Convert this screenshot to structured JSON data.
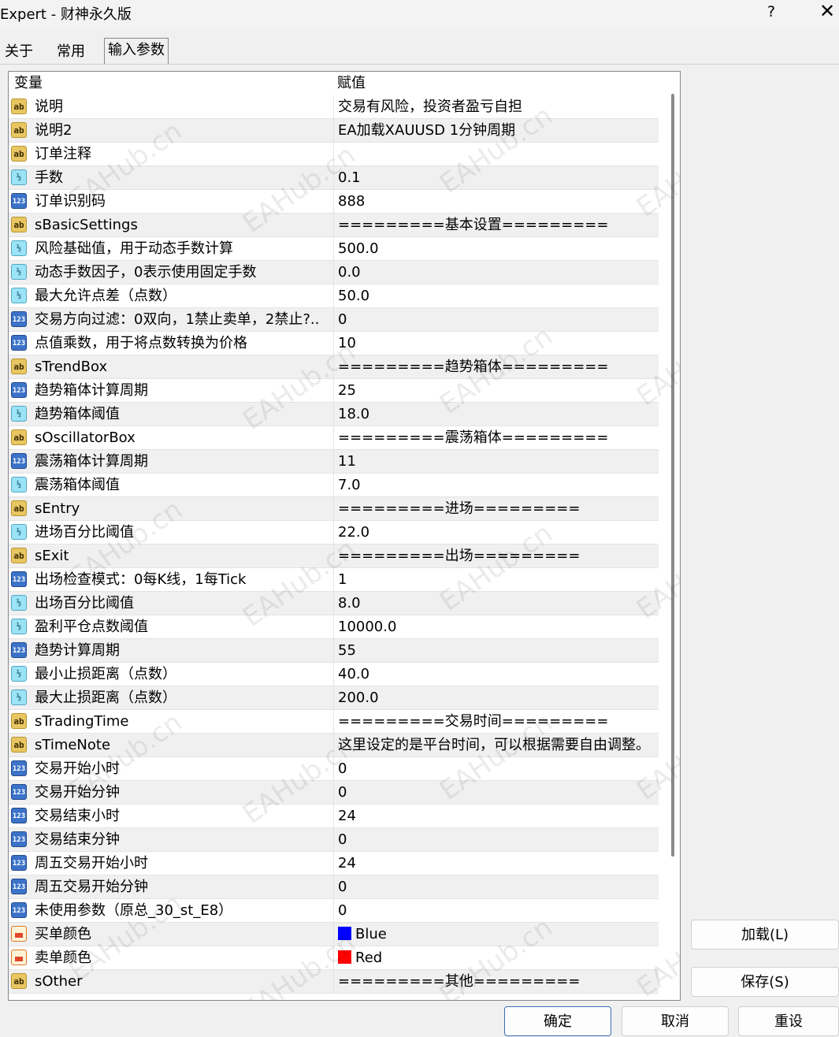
{
  "window": {
    "title": "Expert - 财神永久版",
    "help_label": "?",
    "close_label": "✕"
  },
  "tabs": [
    {
      "label": "关于"
    },
    {
      "label": "常用"
    },
    {
      "label": "输入参数",
      "active": true
    }
  ],
  "table": {
    "headers": {
      "name": "变量",
      "value": "赋值"
    },
    "rows": [
      {
        "type": "ab",
        "name": "说明",
        "value": "交易有风险，投资者盈亏自担"
      },
      {
        "type": "ab",
        "name": "说明2",
        "value": "EA加载XAUUSD 1分钟周期"
      },
      {
        "type": "ab",
        "name": "订单注释",
        "value": ""
      },
      {
        "type": "half",
        "name": "手数",
        "value": "0.1"
      },
      {
        "type": "num",
        "name": "订单识别码",
        "value": "888"
      },
      {
        "type": "ab",
        "name": "sBasicSettings",
        "value": "=========基本设置========="
      },
      {
        "type": "half",
        "name": "风险基础值，用于动态手数计算",
        "value": "500.0"
      },
      {
        "type": "half",
        "name": "动态手数因子，0表示使用固定手数",
        "value": "0.0"
      },
      {
        "type": "half",
        "name": "最大允许点差（点数）",
        "value": "50.0"
      },
      {
        "type": "num",
        "name": "交易方向过滤：0双向，1禁止卖单，2禁止?..",
        "value": "0"
      },
      {
        "type": "num",
        "name": "点值乘数，用于将点数转换为价格",
        "value": "10"
      },
      {
        "type": "ab",
        "name": "sTrendBox",
        "value": "=========趋势箱体========="
      },
      {
        "type": "num",
        "name": "趋势箱体计算周期",
        "value": "25"
      },
      {
        "type": "half",
        "name": "趋势箱体阈值",
        "value": "18.0"
      },
      {
        "type": "ab",
        "name": "sOscillatorBox",
        "value": "=========震荡箱体========="
      },
      {
        "type": "num",
        "name": "震荡箱体计算周期",
        "value": "11"
      },
      {
        "type": "half",
        "name": "震荡箱体阈值",
        "value": "7.0"
      },
      {
        "type": "ab",
        "name": "sEntry",
        "value": "=========进场========="
      },
      {
        "type": "half",
        "name": "进场百分比阈值",
        "value": "22.0"
      },
      {
        "type": "ab",
        "name": "sExit",
        "value": "=========出场========="
      },
      {
        "type": "num",
        "name": "出场检查模式：0每K线，1每Tick",
        "value": "1"
      },
      {
        "type": "half",
        "name": "出场百分比阈值",
        "value": "8.0"
      },
      {
        "type": "half",
        "name": "盈利平仓点数阈值",
        "value": "10000.0"
      },
      {
        "type": "num",
        "name": "趋势计算周期",
        "value": "55"
      },
      {
        "type": "half",
        "name": "最小止损距离（点数）",
        "value": "40.0"
      },
      {
        "type": "half",
        "name": "最大止损距离（点数）",
        "value": "200.0"
      },
      {
        "type": "ab",
        "name": "sTradingTime",
        "value": "=========交易时间========="
      },
      {
        "type": "ab",
        "name": "sTimeNote",
        "value": "这里设定的是平台时间，可以根据需要自由调整。"
      },
      {
        "type": "num",
        "name": "交易开始小时",
        "value": "0"
      },
      {
        "type": "num",
        "name": "交易开始分钟",
        "value": "0"
      },
      {
        "type": "num",
        "name": "交易结束小时",
        "value": "24"
      },
      {
        "type": "num",
        "name": "交易结束分钟",
        "value": "0"
      },
      {
        "type": "num",
        "name": "周五交易开始小时",
        "value": "24"
      },
      {
        "type": "num",
        "name": "周五交易开始分钟",
        "value": "0"
      },
      {
        "type": "num",
        "name": "未使用参数（原总_30_st_E8）",
        "value": "0"
      },
      {
        "type": "color",
        "name": "买单颜色",
        "value": "Blue",
        "swatch": "#0000ff"
      },
      {
        "type": "color",
        "name": "卖单颜色",
        "value": "Red",
        "swatch": "#ff0000"
      },
      {
        "type": "ab",
        "name": "sOther",
        "value": "=========其他========="
      }
    ]
  },
  "icons": {
    "ab": "ab",
    "half": "½",
    "num": "123",
    "color": ""
  },
  "side_buttons": {
    "load": "加载(L)",
    "save": "保存(S)"
  },
  "footer_buttons": {
    "ok": "确定",
    "cancel": "取消",
    "reset": "重设"
  },
  "watermark": "EAHub.cn"
}
